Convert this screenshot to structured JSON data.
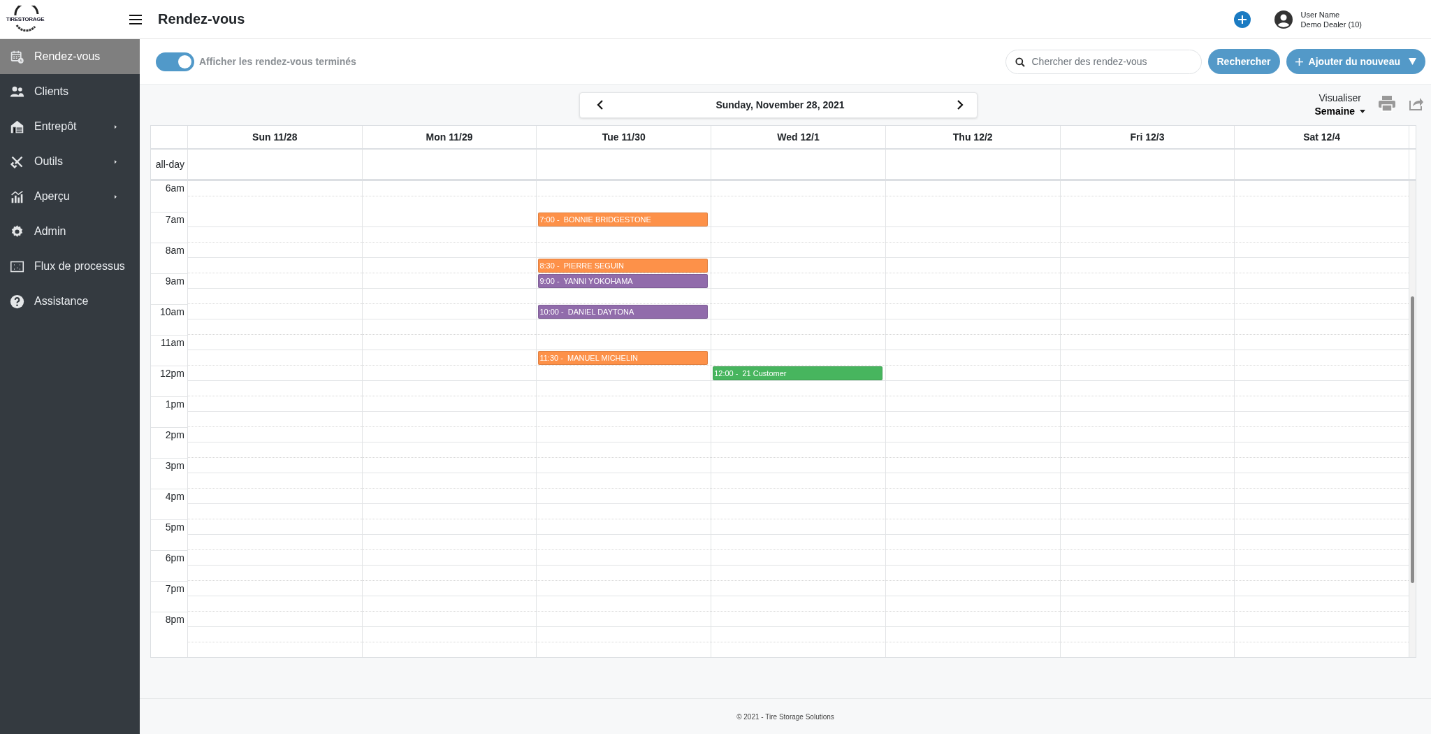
{
  "logo": {
    "text": "TIRESTORAGE"
  },
  "header": {
    "title": "Rendez-vous",
    "user_name": "User Name",
    "dealer": "Demo Dealer (10)"
  },
  "sidebar": {
    "items": [
      {
        "label": "Rendez-vous",
        "selected": true,
        "has_submenu": false
      },
      {
        "label": "Clients",
        "selected": false,
        "has_submenu": false
      },
      {
        "label": "Entrepôt",
        "selected": false,
        "has_submenu": true
      },
      {
        "label": "Outils",
        "selected": false,
        "has_submenu": true
      },
      {
        "label": "Aperçu",
        "selected": false,
        "has_submenu": true
      },
      {
        "label": "Admin",
        "selected": false,
        "has_submenu": false
      },
      {
        "label": "Flux de processus",
        "selected": false,
        "has_submenu": false
      },
      {
        "label": "Assistance",
        "selected": false,
        "has_submenu": false
      }
    ]
  },
  "toolbar": {
    "toggle": {
      "label": "Afficher les rendez-vous terminés",
      "on": true
    },
    "search": {
      "placeholder": "Chercher des rendez-vous"
    },
    "search_button": "Rechercher",
    "add_button": "Ajouter du nouveau"
  },
  "calendar": {
    "date_title": "Sunday, November 28, 2021",
    "view_label": "Visualiser",
    "view_value": "Semaine",
    "all_day_label": "all-day",
    "hours": [
      "6am",
      "7am",
      "8am",
      "9am",
      "10am",
      "11am",
      "12pm",
      "1pm",
      "2pm",
      "3pm",
      "4pm",
      "5pm",
      "6pm",
      "7pm",
      "8pm"
    ],
    "days": [
      {
        "label": "Sun 11/28"
      },
      {
        "label": "Mon 11/29"
      },
      {
        "label": "Tue 11/30",
        "events": [
          {
            "time": "7:00 -",
            "title": "BONNIE BRIDGESTONE",
            "color": "#fd9149"
          },
          {
            "time": "8:30 -",
            "title": "PIERRE SEGUIN",
            "color": "#fd9149"
          },
          {
            "time": "9:00 -",
            "title": "YANNI YOKOHAMA",
            "color": "#916cab"
          },
          {
            "time": "10:00 -",
            "title": "DANIEL DAYTONA",
            "color": "#916cab"
          },
          {
            "time": "11:30 -",
            "title": "MANUEL MICHELIN",
            "color": "#fd9149"
          }
        ]
      },
      {
        "label": "Wed 12/1",
        "events": [
          {
            "time": "12:00 -",
            "title": "21 Customer",
            "color": "#47b55e"
          }
        ]
      },
      {
        "label": "Thu 12/2"
      },
      {
        "label": "Fri 12/3"
      },
      {
        "label": "Sat 12/4"
      }
    ]
  },
  "footer": {
    "text": "© 2021 - Tire Storage Solutions"
  }
}
